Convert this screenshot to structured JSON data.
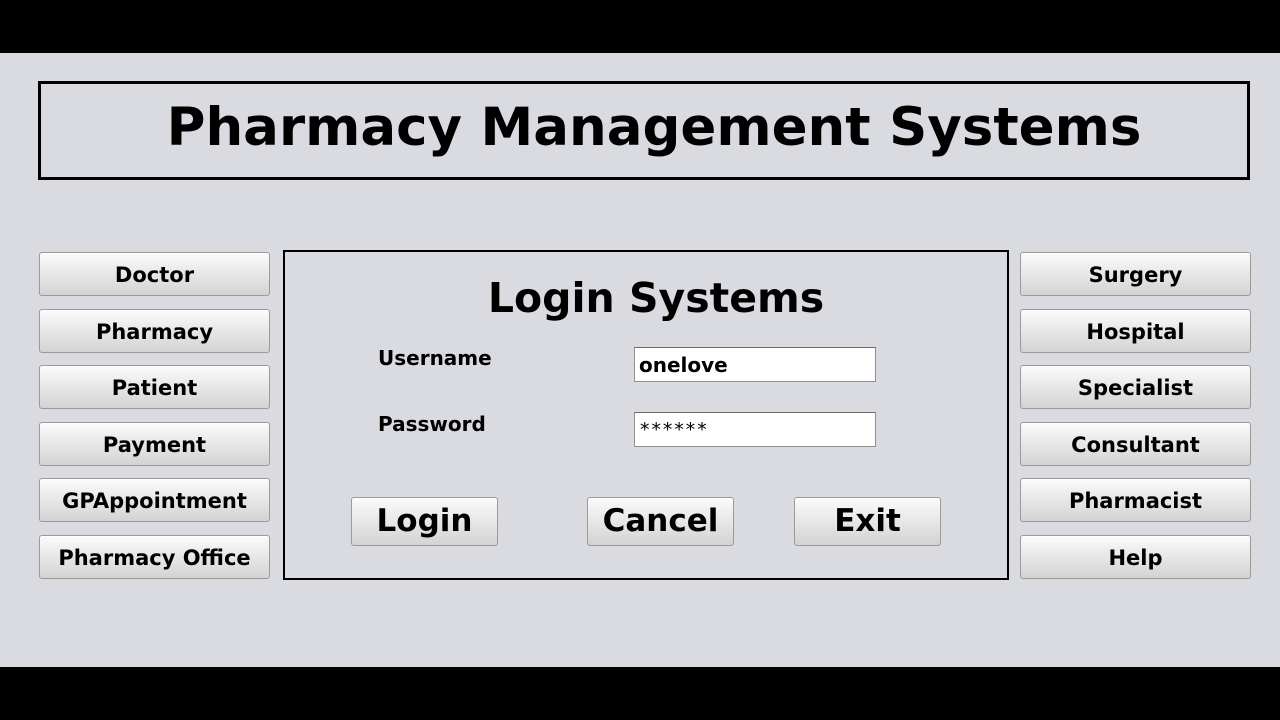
{
  "app": {
    "title": "Pharmacy Management Systems"
  },
  "left_menu": {
    "items": [
      {
        "label": "Doctor"
      },
      {
        "label": "Pharmacy"
      },
      {
        "label": "Patient"
      },
      {
        "label": "Payment"
      },
      {
        "label": "GPAppointment"
      },
      {
        "label": "Pharmacy Office"
      }
    ]
  },
  "right_menu": {
    "items": [
      {
        "label": "Surgery"
      },
      {
        "label": "Hospital"
      },
      {
        "label": "Specialist"
      },
      {
        "label": "Consultant"
      },
      {
        "label": "Pharmacist"
      },
      {
        "label": "Help"
      }
    ]
  },
  "login": {
    "title": "Login Systems",
    "username_label": "Username",
    "username_value": "onelove",
    "password_label": "Password",
    "password_value": "******",
    "login_label": "Login",
    "cancel_label": "Cancel",
    "exit_label": "Exit"
  },
  "colors": {
    "window_bg": "#d9dbe1",
    "letterbox": "#000000",
    "border": "#000000"
  }
}
